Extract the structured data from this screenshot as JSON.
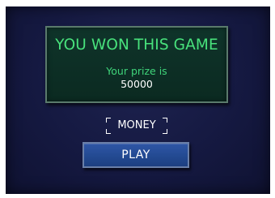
{
  "result": {
    "title": "YOU WON THIS GAME",
    "prize_label": "Your prize is",
    "prize_amount": "50000"
  },
  "buttons": {
    "money_label": "MONEY",
    "play_label": "PLAY"
  },
  "colors": {
    "background": "#151941",
    "panel": "#0f342a",
    "title_green": "#48e27c",
    "play_blue": "#2f56a6"
  }
}
